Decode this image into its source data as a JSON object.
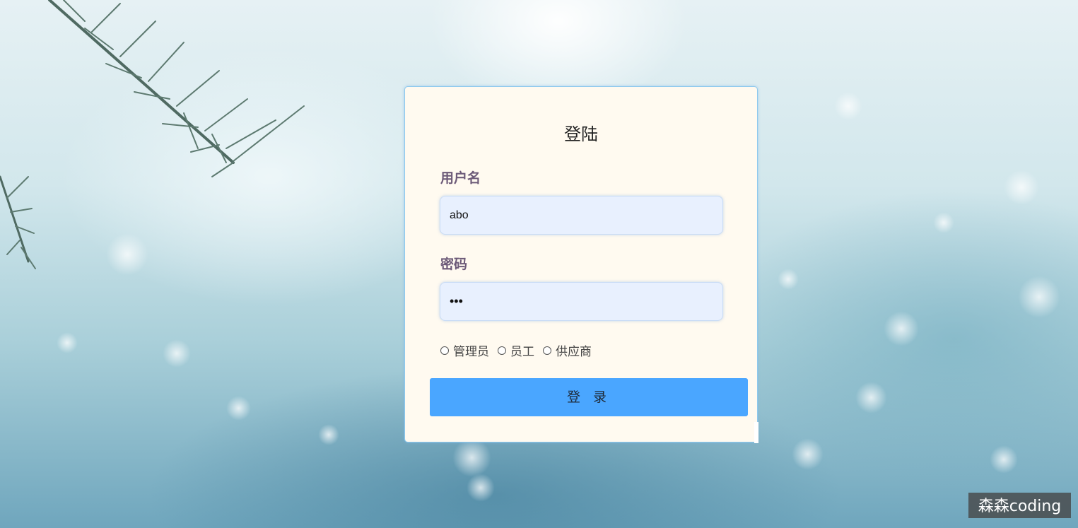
{
  "login": {
    "title": "登陆",
    "username_label": "用户名",
    "username_value": "abo",
    "password_label": "密码",
    "password_display": "•••",
    "roles": [
      "管理员",
      "员工",
      "供应商"
    ],
    "submit_label": "登 录"
  },
  "watermark": "森森coding",
  "colors": {
    "card_bg": "#fffaf0",
    "button": "#4aa6ff",
    "input_bg": "#e8f0fe",
    "label": "#6c5a78"
  }
}
